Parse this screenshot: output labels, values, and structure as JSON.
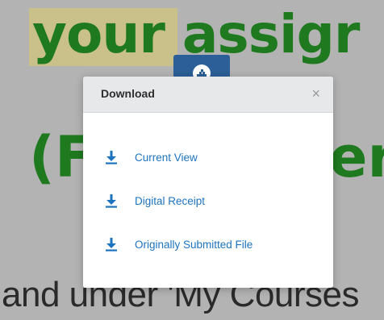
{
  "background": {
    "heading_word1": "your",
    "heading_word2": "assigr",
    "paren_left": "(F",
    "paren_right": "er",
    "bottom_text": "and under 'My Courses"
  },
  "modal": {
    "title": "Download",
    "close_label": "×",
    "options": [
      {
        "label": "Current View",
        "icon": "download-icon"
      },
      {
        "label": "Digital Receipt",
        "icon": "download-icon"
      },
      {
        "label": "Originally Submitted File",
        "icon": "download-icon"
      }
    ]
  },
  "colors": {
    "accent": "#1e73be",
    "heading_green": "#1f7a1f",
    "highlight": "#c9c08a",
    "overlay": "#b3b3b3",
    "tab_blue": "#2c5f97"
  }
}
